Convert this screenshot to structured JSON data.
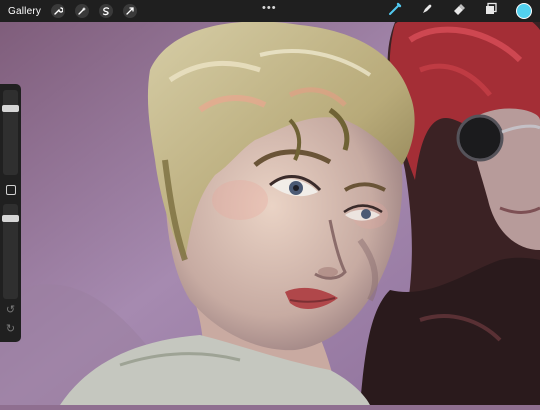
{
  "top_bar": {
    "gallery_label": "Gallery",
    "left_tools": [
      "wrench-icon",
      "magic-wand-icon",
      "selection-icon",
      "transform-icon"
    ],
    "center_menu": "•••",
    "right_tools": [
      "brush-icon",
      "smudge-icon",
      "eraser-icon",
      "layers-icon"
    ],
    "current_color": "#52d2f0"
  },
  "sidebar": {
    "brush_size_level": 0.18,
    "opacity_level": 0.12,
    "undo_icon": "↺",
    "redo_icon": "↻"
  }
}
